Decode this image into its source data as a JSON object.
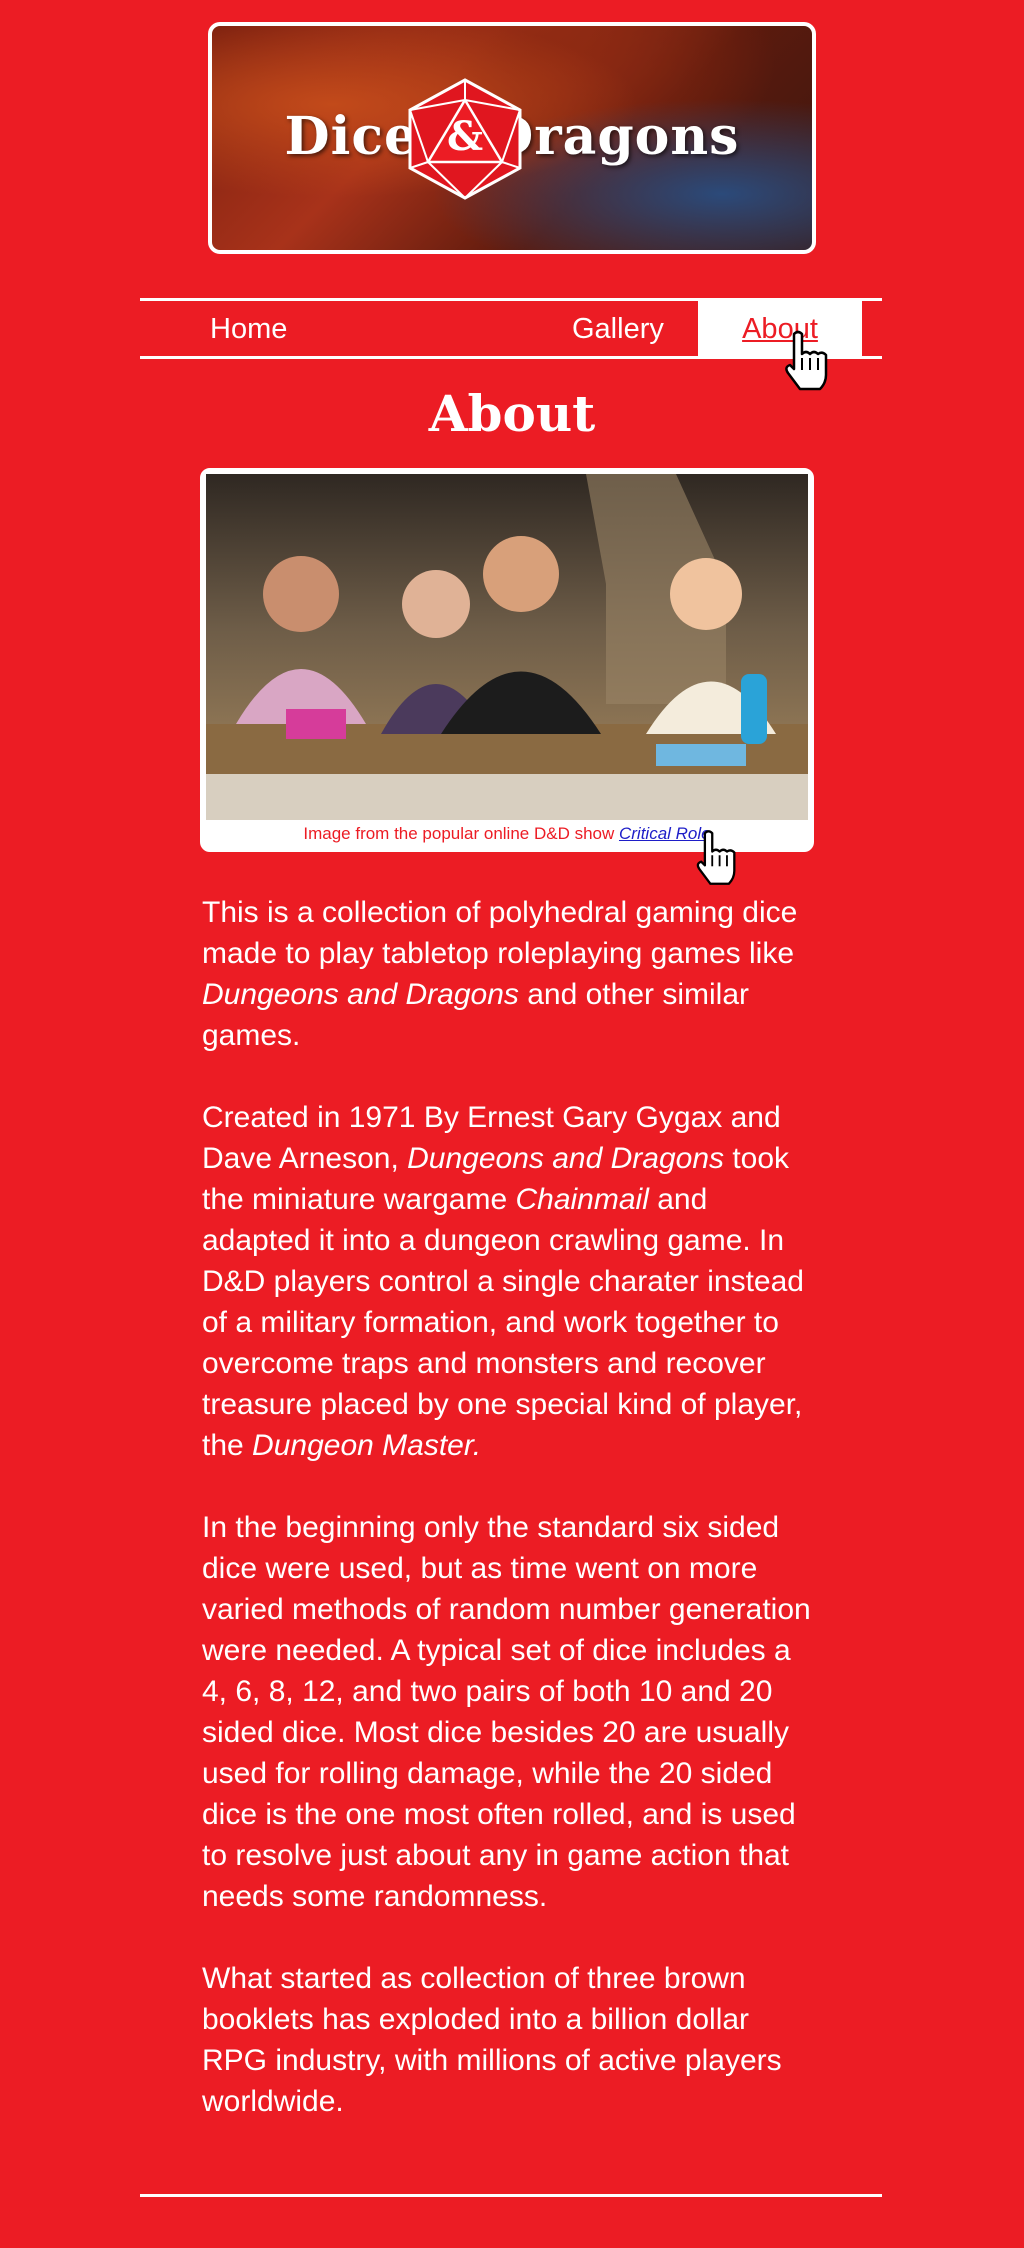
{
  "banner": {
    "title_left": "Dice",
    "title_right": "Dragons",
    "logo_symbol": "&",
    "logo_icon": "d20-dice-icon"
  },
  "nav": {
    "items": [
      {
        "label": "Home"
      },
      {
        "label": "Gallery"
      },
      {
        "label": "About",
        "active": true
      }
    ]
  },
  "page": {
    "title": "About"
  },
  "photo": {
    "caption_text": "Image from the popular online D&D show ",
    "caption_link": "Critical Role"
  },
  "content": {
    "p1_a": "This is a collection of polyhedral gaming dice made to play tabletop roleplaying games like ",
    "p1_em": "Dungeons and Dragons",
    "p1_b": " and other similar games.",
    "p2_a": "Created in 1971 By Ernest Gary Gygax and Dave Arneson, ",
    "p2_em1": "Dungeons and Dragons",
    "p2_b": " took the miniature wargame ",
    "p2_em2": "Chainmail",
    "p2_c": " and adapted it into a dungeon crawling game. In D&D players control a single charater instead of a military formation, and work together to overcome traps and monsters and recover treasure placed by one special kind of player, the ",
    "p2_em3": "Dungeon Master.",
    "p3": "In the beginning only the standard six sided dice were used, but as time went on more varied methods of random number generation were needed. A typical set of dice includes a 4, 6, 8, 12, and two pairs of both 10 and 20 sided dice. Most dice besides 20 are usually used for rolling damage, while the 20 sided dice is the one most often rolled, and is used to resolve just about any in game action that needs some randomness.",
    "p4": "What started as collection of three brown booklets has exploded into a billion dollar RPG industry, with millions of active players worldwide."
  },
  "colors": {
    "background": "#ec1c24",
    "text": "#ffffff",
    "link": "#1e1ec8"
  }
}
